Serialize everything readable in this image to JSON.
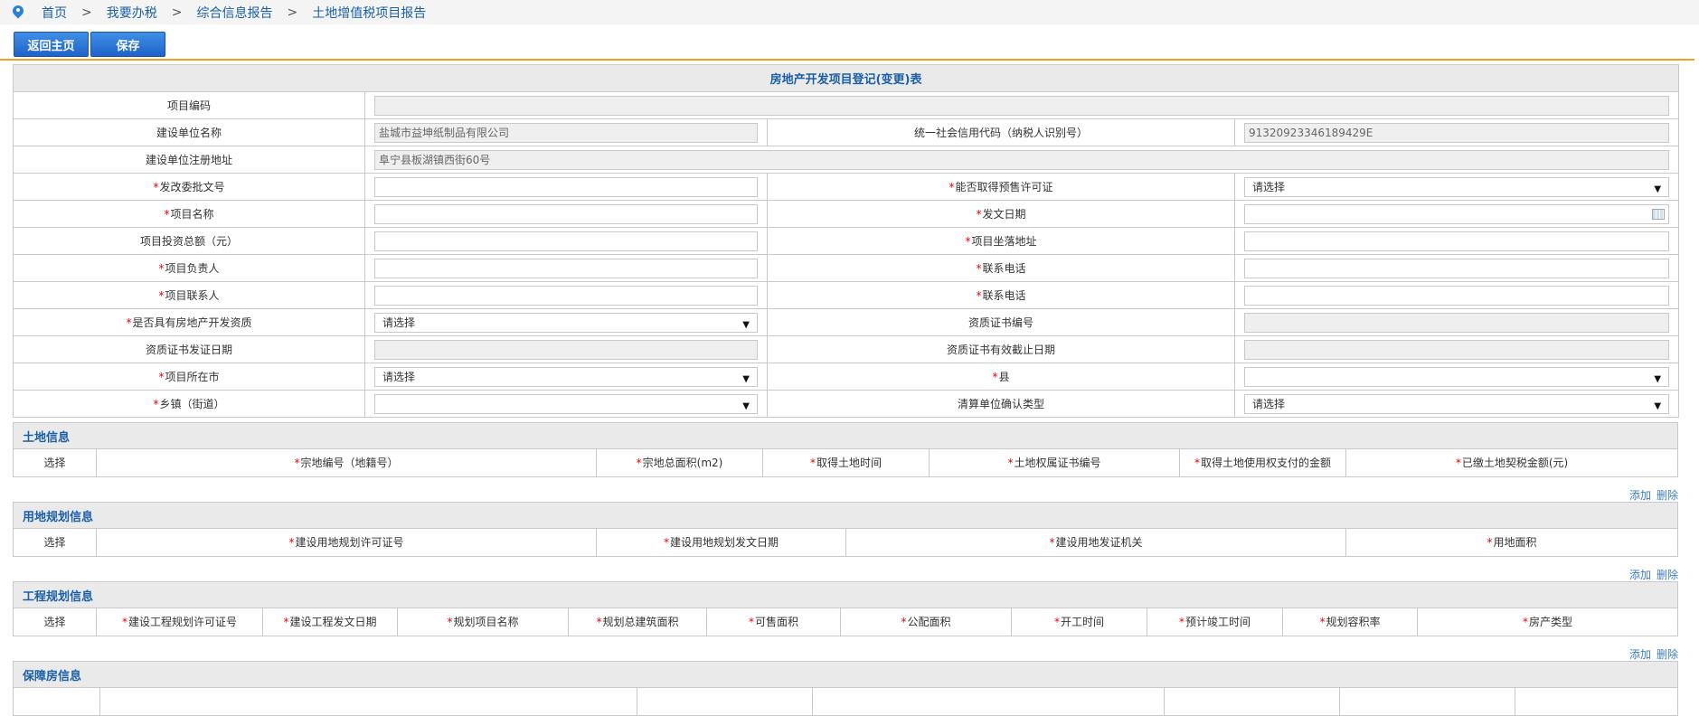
{
  "breadcrumb": [
    "首页",
    "我要办税",
    "综合信息报告",
    "土地增值税项目报告"
  ],
  "toolbar": {
    "home": "返回主页",
    "save": "保存"
  },
  "form": {
    "title": "房地产开发项目登记(变更)表",
    "project_code": "项目编码",
    "builder_name": "建设单位名称",
    "builder_name_val": "盐城市益坤纸制品有限公司",
    "credit_code": "统一社会信用代码（纳税人识别号）",
    "credit_code_val": "91320923346189429E",
    "reg_addr": "建设单位注册地址",
    "reg_addr_val": "阜宁县板湖镇西街60号",
    "approval_no": "发改委批文号",
    "presale": "能否取得预售许可证",
    "project_name": "项目名称",
    "issue_date": "发文日期",
    "invest": "项目投资总额（元）",
    "location": "项目坐落地址",
    "leader": "项目负责人",
    "phone1": "联系电话",
    "contact": "项目联系人",
    "phone2": "联系电话",
    "qualified": "是否具有房地产开发资质",
    "cert_no": "资质证书编号",
    "cert_date": "资质证书发证日期",
    "cert_expire": "资质证书有效截止日期",
    "city": "项目所在市",
    "county": "县",
    "town": "乡镇（街道）",
    "settle_type": "清算单位确认类型",
    "select_placeholder": "请选择"
  },
  "sections": {
    "land": {
      "title": "土地信息",
      "cols": [
        "选择",
        "宗地编号（地籍号）",
        "宗地总面积(m2)",
        "取得土地时间",
        "土地权属证书编号",
        "取得土地使用权支付的金额",
        "已缴土地契税金额(元)"
      ]
    },
    "plan": {
      "title": "用地规划信息",
      "cols": [
        "选择",
        "建设用地规划许可证号",
        "建设用地规划发文日期",
        "建设用地发证机关",
        "用地面积"
      ]
    },
    "eng": {
      "title": "工程规划信息",
      "cols": [
        "选择",
        "建设工程规划许可证号",
        "建设工程发文日期",
        "规划项目名称",
        "规划总建筑面积",
        "可售面积",
        "公配面积",
        "开工时间",
        "预计竣工时间",
        "规划容积率",
        "房产类型"
      ]
    },
    "house": {
      "title": "保障房信息"
    }
  },
  "ops": {
    "add": "添加",
    "del": "删除"
  }
}
